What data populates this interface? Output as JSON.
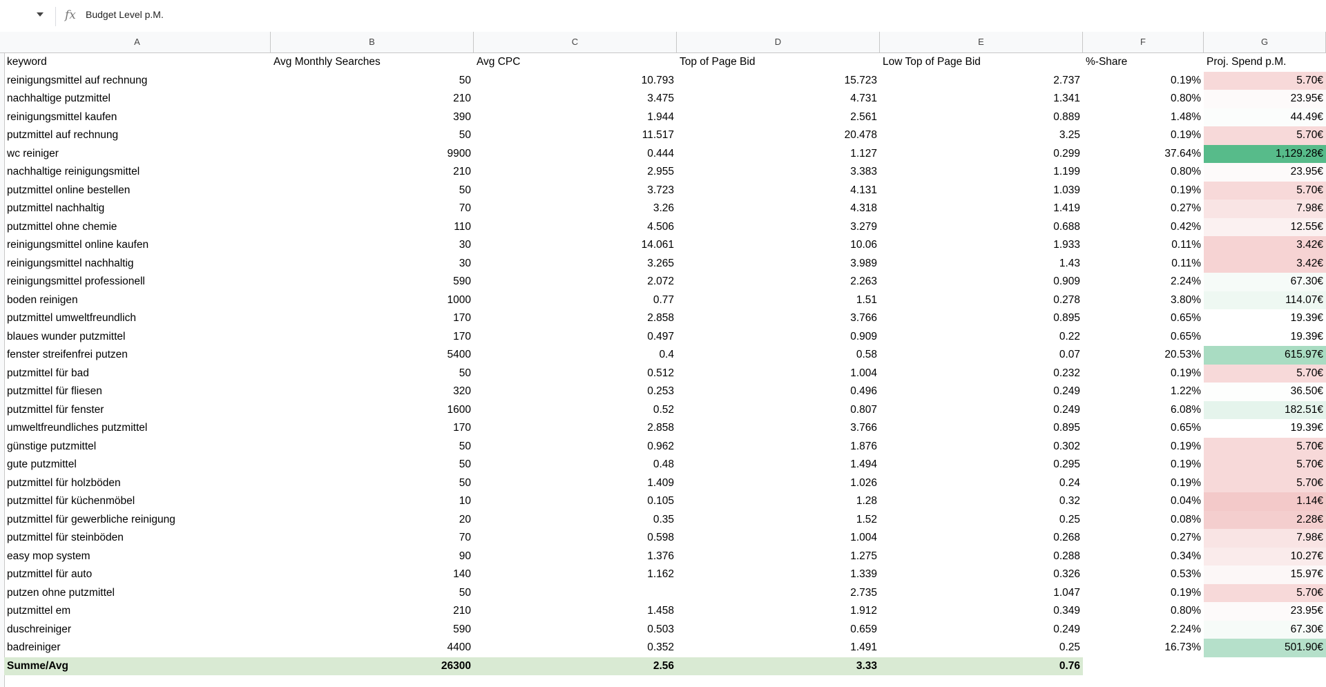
{
  "formula_bar": {
    "fx_icon": "fx-icon",
    "content": "Budget Level p.M."
  },
  "columns": [
    "A",
    "B",
    "C",
    "D",
    "E",
    "F",
    "G"
  ],
  "headers": [
    "keyword",
    "Avg Monthly Searches",
    "Avg CPC",
    "Top of Page Bid",
    "Low Top of Page Bid",
    "%-Share",
    "Proj. Spend p.M."
  ],
  "rows": [
    {
      "keyword": "reinigungsmittel auf rechnung",
      "searches": "50",
      "cpc": "10.793",
      "top_bid": "15.723",
      "low_bid": "2.737",
      "share": "0.19%",
      "spend": "5.70€",
      "spend_color": "#f7d9d9"
    },
    {
      "keyword": "nachhaltige putzmittel",
      "searches": "210",
      "cpc": "3.475",
      "top_bid": "4.731",
      "low_bid": "1.341",
      "share": "0.80%",
      "spend": "23.95€",
      "spend_color": "#fdfafa"
    },
    {
      "keyword": "reinigungsmittel kaufen",
      "searches": "390",
      "cpc": "1.944",
      "top_bid": "2.561",
      "low_bid": "0.889",
      "share": "1.48%",
      "spend": "44.49€",
      "spend_color": "#fbfdfc"
    },
    {
      "keyword": "putzmittel auf rechnung",
      "searches": "50",
      "cpc": "11.517",
      "top_bid": "20.478",
      "low_bid": "3.25",
      "share": "0.19%",
      "spend": "5.70€",
      "spend_color": "#f7d9d9"
    },
    {
      "keyword": "wc reiniger",
      "searches": "9900",
      "cpc": "0.444",
      "top_bid": "1.127",
      "low_bid": "0.299",
      "share": "37.64%",
      "spend": "1,129.28€",
      "spend_color": "#57bb8a"
    },
    {
      "keyword": "nachhaltige reinigungsmittel",
      "searches": "210",
      "cpc": "2.955",
      "top_bid": "3.383",
      "low_bid": "1.199",
      "share": "0.80%",
      "spend": "23.95€",
      "spend_color": "#fdfafa"
    },
    {
      "keyword": "putzmittel online bestellen",
      "searches": "50",
      "cpc": "3.723",
      "top_bid": "4.131",
      "low_bid": "1.039",
      "share": "0.19%",
      "spend": "5.70€",
      "spend_color": "#f7d9d9"
    },
    {
      "keyword": "putzmittel nachhaltig",
      "searches": "70",
      "cpc": "3.26",
      "top_bid": "4.318",
      "low_bid": "1.419",
      "share": "0.27%",
      "spend": "7.98€",
      "spend_color": "#f9e4e4"
    },
    {
      "keyword": "putzmittel ohne chemie",
      "searches": "110",
      "cpc": "4.506",
      "top_bid": "3.279",
      "low_bid": "0.688",
      "share": "0.42%",
      "spend": "12.55€",
      "spend_color": "#fbf1f1"
    },
    {
      "keyword": "reinigungsmittel online kaufen",
      "searches": "30",
      "cpc": "14.061",
      "top_bid": "10.06",
      "low_bid": "1.933",
      "share": "0.11%",
      "spend": "3.42€",
      "spend_color": "#f6d3d3"
    },
    {
      "keyword": "reinigungsmittel nachhaltig",
      "searches": "30",
      "cpc": "3.265",
      "top_bid": "3.989",
      "low_bid": "1.43",
      "share": "0.11%",
      "spend": "3.42€",
      "spend_color": "#f6d3d3"
    },
    {
      "keyword": "reinigungsmittel professionell",
      "searches": "590",
      "cpc": "2.072",
      "top_bid": "2.263",
      "low_bid": "0.909",
      "share": "2.24%",
      "spend": "67.30€",
      "spend_color": "#f6fbf8"
    },
    {
      "keyword": "boden reinigen",
      "searches": "1000",
      "cpc": "0.77",
      "top_bid": "1.51",
      "low_bid": "0.278",
      "share": "3.80%",
      "spend": "114.07€",
      "spend_color": "#eef8f2"
    },
    {
      "keyword": "putzmittel umweltfreundlich",
      "searches": "170",
      "cpc": "2.858",
      "top_bid": "3.766",
      "low_bid": "0.895",
      "share": "0.65%",
      "spend": "19.39€",
      "spend_color": "#ffffff"
    },
    {
      "keyword": "blaues wunder putzmittel",
      "searches": "170",
      "cpc": "0.497",
      "top_bid": "0.909",
      "low_bid": "0.22",
      "share": "0.65%",
      "spend": "19.39€",
      "spend_color": "#ffffff"
    },
    {
      "keyword": "fenster streifenfrei putzen",
      "searches": "5400",
      "cpc": "0.4",
      "top_bid": "0.58",
      "low_bid": "0.07",
      "share": "20.53%",
      "spend": "615.97€",
      "spend_color": "#a9dcc2"
    },
    {
      "keyword": "putzmittel für bad",
      "searches": "50",
      "cpc": "0.512",
      "top_bid": "1.004",
      "low_bid": "0.232",
      "share": "0.19%",
      "spend": "5.70€",
      "spend_color": "#f7d9d9"
    },
    {
      "keyword": "putzmittel für fliesen",
      "searches": "320",
      "cpc": "0.253",
      "top_bid": "0.496",
      "low_bid": "0.249",
      "share": "1.22%",
      "spend": "36.50€",
      "spend_color": "#fdfefd"
    },
    {
      "keyword": "putzmittel für fenster",
      "searches": "1600",
      "cpc": "0.52",
      "top_bid": "0.807",
      "low_bid": "0.249",
      "share": "6.08%",
      "spend": "182.51€",
      "spend_color": "#e5f4ec"
    },
    {
      "keyword": "umweltfreundliches putzmittel",
      "searches": "170",
      "cpc": "2.858",
      "top_bid": "3.766",
      "low_bid": "0.895",
      "share": "0.65%",
      "spend": "19.39€",
      "spend_color": "#ffffff"
    },
    {
      "keyword": "günstige putzmittel",
      "searches": "50",
      "cpc": "0.962",
      "top_bid": "1.876",
      "low_bid": "0.302",
      "share": "0.19%",
      "spend": "5.70€",
      "spend_color": "#f7d9d9"
    },
    {
      "keyword": "gute putzmittel",
      "searches": "50",
      "cpc": "0.48",
      "top_bid": "1.494",
      "low_bid": "0.295",
      "share": "0.19%",
      "spend": "5.70€",
      "spend_color": "#f7d9d9"
    },
    {
      "keyword": "putzmittel für holzböden",
      "searches": "50",
      "cpc": "1.409",
      "top_bid": "1.026",
      "low_bid": "0.24",
      "share": "0.19%",
      "spend": "5.70€",
      "spend_color": "#f7d9d9"
    },
    {
      "keyword": "putzmittel für küchenmöbel",
      "searches": "10",
      "cpc": "0.105",
      "top_bid": "1.28",
      "low_bid": "0.32",
      "share": "0.04%",
      "spend": "1.14€",
      "spend_color": "#f3c9c9"
    },
    {
      "keyword": "putzmittel für gewerbliche reinigung",
      "searches": "20",
      "cpc": "0.35",
      "top_bid": "1.52",
      "low_bid": "0.25",
      "share": "0.08%",
      "spend": "2.28€",
      "spend_color": "#f4cece"
    },
    {
      "keyword": "putzmittel für steinböden",
      "searches": "70",
      "cpc": "0.598",
      "top_bid": "1.004",
      "low_bid": "0.268",
      "share": "0.27%",
      "spend": "7.98€",
      "spend_color": "#f9e4e4"
    },
    {
      "keyword": "easy mop system",
      "searches": "90",
      "cpc": "1.376",
      "top_bid": "1.275",
      "low_bid": "0.288",
      "share": "0.34%",
      "spend": "10.27€",
      "spend_color": "#faebeb"
    },
    {
      "keyword": "putzmittel für auto",
      "searches": "140",
      "cpc": "1.162",
      "top_bid": "1.339",
      "low_bid": "0.326",
      "share": "0.53%",
      "spend": "15.97€",
      "spend_color": "#fcf7f7"
    },
    {
      "keyword": "putzen ohne putzmittel",
      "searches": "50",
      "cpc": "",
      "top_bid": "2.735",
      "low_bid": "1.047",
      "share": "0.19%",
      "spend": "5.70€",
      "spend_color": "#f7d9d9"
    },
    {
      "keyword": "putzmittel em",
      "searches": "210",
      "cpc": "1.458",
      "top_bid": "1.912",
      "low_bid": "0.349",
      "share": "0.80%",
      "spend": "23.95€",
      "spend_color": "#fdfafa"
    },
    {
      "keyword": "duschreiniger",
      "searches": "590",
      "cpc": "0.503",
      "top_bid": "0.659",
      "low_bid": "0.249",
      "share": "2.24%",
      "spend": "67.30€",
      "spend_color": "#f6fbf8"
    },
    {
      "keyword": "badreiniger",
      "searches": "4400",
      "cpc": "0.352",
      "top_bid": "1.491",
      "low_bid": "0.25",
      "share": "16.73%",
      "spend": "501.90€",
      "spend_color": "#b5e0ca"
    }
  ],
  "summary": {
    "label": "Summe/Avg",
    "searches": "26300",
    "cpc": "2.56",
    "top_bid": "3.33",
    "low_bid": "0.76",
    "color": "#d9ead3"
  }
}
